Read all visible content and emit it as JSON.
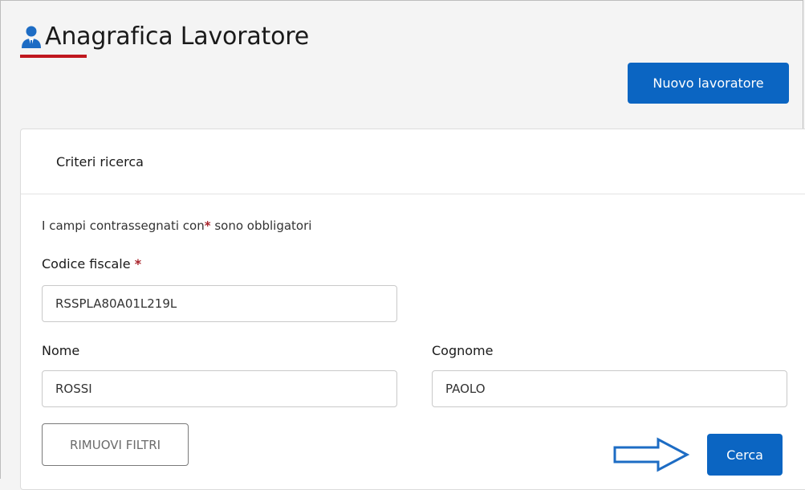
{
  "header": {
    "title": "Anagrafica Lavoratore",
    "icon": "user-icon",
    "new_button_label": "Nuovo lavoratore"
  },
  "card": {
    "title": "Criteri ricerca",
    "hint_prefix": "I campi contrassegnati con",
    "hint_asterisk": "*",
    "hint_suffix": " sono obbligatori"
  },
  "form": {
    "codice_fiscale": {
      "label": "Codice fiscale",
      "required_mark": "*",
      "value": "RSSPLA80A01L219L"
    },
    "nome": {
      "label": "Nome",
      "value": "ROSSI"
    },
    "cognome": {
      "label": "Cognome",
      "value": "PAOLO"
    }
  },
  "actions": {
    "reset_label": "RIMUOVI FILTRI",
    "search_label": "Cerca"
  },
  "colors": {
    "primary": "#0b65c2",
    "accent_red": "#c0181e",
    "required_red": "#a8222a"
  }
}
